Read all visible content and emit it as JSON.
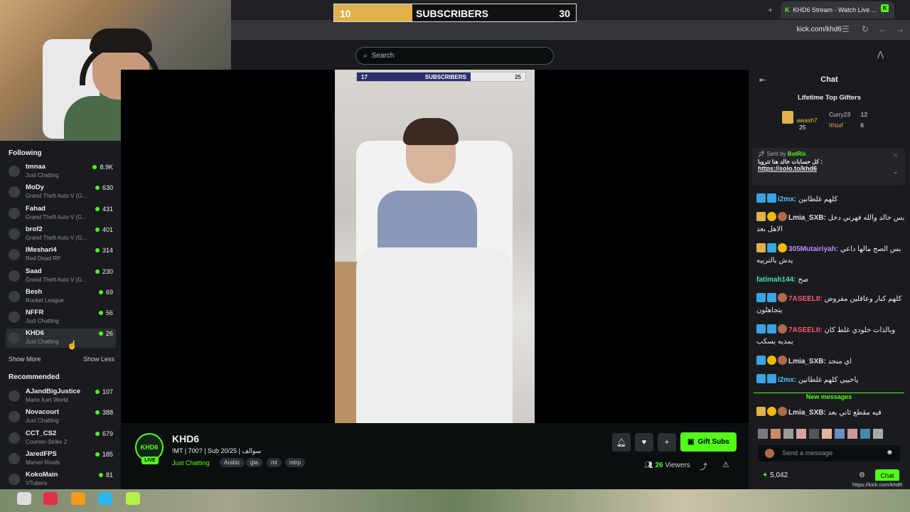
{
  "browser": {
    "tab_title": "KHD6 Stream - Watch Live ...",
    "url": "kick.com/khd6"
  },
  "header": {
    "search_placeholder": "Search"
  },
  "stream_overlay": {
    "sub_goal_current": "10",
    "sub_goal_label": "SUBSCRIBERS",
    "sub_goal_target": "30"
  },
  "video_overlay": {
    "sub_goal_current": "17",
    "sub_goal_label": "SUBSCRIBERS",
    "sub_goal_target": "25"
  },
  "sidebar": {
    "following_label": "Following",
    "following": [
      {
        "name": "tmnaa",
        "category": "Just Chatting",
        "viewers": "8.9K"
      },
      {
        "name": "MoDy",
        "category": "Grand Theft Auto V (G...",
        "viewers": "630"
      },
      {
        "name": "Fahad",
        "category": "Grand Theft Auto V (G...",
        "viewers": "431"
      },
      {
        "name": "brof2",
        "category": "Grand Theft Auto V (G...",
        "viewers": "401"
      },
      {
        "name": "IMeshari4",
        "category": "Red Dead RP",
        "viewers": "314"
      },
      {
        "name": "Saad",
        "category": "Grand Theft Auto V (G...",
        "viewers": "230"
      },
      {
        "name": "Besh",
        "category": "Rocket League",
        "viewers": "69"
      },
      {
        "name": "NFFR",
        "category": "Just Chatting",
        "viewers": "56"
      },
      {
        "name": "KHD6",
        "category": "Just Chatting",
        "viewers": "26"
      }
    ],
    "show_more": "Show More",
    "show_less": "Show Less",
    "recommended_label": "Recommended",
    "recommended": [
      {
        "name": "AJandBigJustice",
        "category": "Mario Kart World",
        "viewers": "107"
      },
      {
        "name": "Novacourt",
        "category": "Just Chatting",
        "viewers": "388"
      },
      {
        "name": "CCT_CS2",
        "category": "Counter-Strike 2",
        "viewers": "679"
      },
      {
        "name": "JaredFPS",
        "category": "Marvel Rivals",
        "viewers": "185"
      },
      {
        "name": "KokoMain",
        "category": "VTubers",
        "viewers": "81"
      }
    ]
  },
  "stream": {
    "name": "KHD6",
    "title": "!MT | 700? | Sub 20/25 | سوالف",
    "category": "Just Chatting",
    "tags": [
      "Arabic",
      "gta",
      "mt",
      "mtrp"
    ],
    "viewers_count": "26",
    "viewers_label": "Viewers",
    "gift_label": "Gift Subs",
    "live_label": "LIVE",
    "avatar_text": "KHD6"
  },
  "chat": {
    "title": "Chat",
    "gifters_title": "Lifetime Top Gifters",
    "gifters": [
      {
        "name": "awash7",
        "count": "25"
      },
      {
        "name": "Curry23",
        "count": "12"
      },
      {
        "name": "IINaif",
        "count": "6"
      }
    ],
    "pinned": {
      "sent_by": "Sent by",
      "bot": "BotRix",
      "text": "كل حسابات خالد هنا تتروبا :",
      "link": "https://solo.to/khd6"
    },
    "messages": [
      {
        "user": "i2mx:",
        "text": "كلهم غلطانين",
        "color": "#52c5ff"
      },
      {
        "user": "Lmia_SXB:",
        "text": "بس خالد والله فهرني دخل الاهل بعد",
        "color": "#e0e0e0"
      },
      {
        "user": "305Mutairiyah:",
        "text": "بس الصح مالها داعي يدش بالتربيه",
        "color": "#b98cff"
      },
      {
        "user": "fatimah144:",
        "text": "صح",
        "color": "#52e0a5"
      },
      {
        "user": "7ASEELII:",
        "text": "كلهم كبار وعاقلين مفروض يتجاهلون",
        "color": "#ff5a6e"
      },
      {
        "user": "7ASEELII:",
        "text": "وبالذات خلودي غلط كان يمديه يسكب",
        "color": "#ff5a6e"
      },
      {
        "user": "Lmia_SXB:",
        "text": "اي منجد",
        "color": "#e0e0e0"
      },
      {
        "user": "i2mx:",
        "text": "ياخييي كلهم غلطانين",
        "color": "#52c5ff"
      }
    ],
    "new_messages_label": "New messages",
    "last_message": {
      "user": "Lmia_SXB:",
      "text": "فيه مقطع ثاني بعد",
      "color": "#e0e0e0"
    },
    "input_placeholder": "Send a message",
    "points": "5,042",
    "chat_button": "Chat",
    "url_tooltip": "https://kick.com/khd6"
  }
}
